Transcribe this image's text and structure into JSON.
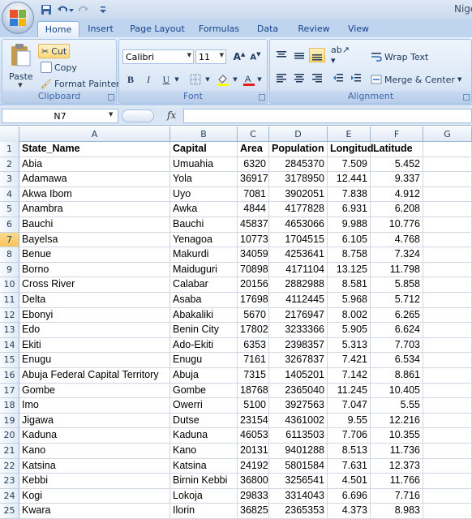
{
  "title_bar": {
    "title": "Nige"
  },
  "tabs": [
    "Home",
    "Insert",
    "Page Layout",
    "Formulas",
    "Data",
    "Review",
    "View"
  ],
  "clipboard": {
    "paste": "Paste",
    "cut": "Cut",
    "copy": "Copy",
    "format_painter": "Format Painter",
    "label": "Clipboard"
  },
  "font": {
    "name": "Calibri",
    "size": "11",
    "label": "Font",
    "bold": "B",
    "italic": "I",
    "underline": "U"
  },
  "alignment": {
    "wrap_text": "Wrap Text",
    "merge_center": "Merge & Center",
    "label": "Alignment"
  },
  "formula_bar": {
    "name_box": "N7",
    "fx": "fx",
    "formula": ""
  },
  "sheet": {
    "columns": [
      "A",
      "B",
      "C",
      "D",
      "E",
      "F",
      "G"
    ],
    "selected_row": 7,
    "rows": [
      [
        "State_Name",
        "Capital",
        "Area",
        "Population",
        "Longitud",
        "Latitude",
        ""
      ],
      [
        "Abia",
        "Umuahia",
        "6320",
        "2845370",
        "7.509",
        "5.452",
        ""
      ],
      [
        "Adamawa",
        "Yola",
        "36917",
        "3178950",
        "12.441",
        "9.337",
        ""
      ],
      [
        "Akwa Ibom",
        "Uyo",
        "7081",
        "3902051",
        "7.838",
        "4.912",
        ""
      ],
      [
        "Anambra",
        "Awka",
        "4844",
        "4177828",
        "6.931",
        "6.208",
        ""
      ],
      [
        "Bauchi",
        "Bauchi",
        "45837",
        "4653066",
        "9.988",
        "10.776",
        ""
      ],
      [
        "Bayelsa",
        "Yenagoa",
        "10773",
        "1704515",
        "6.105",
        "4.768",
        ""
      ],
      [
        "Benue",
        "Makurdi",
        "34059",
        "4253641",
        "8.758",
        "7.324",
        ""
      ],
      [
        "Borno",
        "Maiduguri",
        "70898",
        "4171104",
        "13.125",
        "11.798",
        ""
      ],
      [
        "Cross River",
        "Calabar",
        "20156",
        "2882988",
        "8.581",
        "5.858",
        ""
      ],
      [
        "Delta",
        "Asaba",
        "17698",
        "4112445",
        "5.968",
        "5.712",
        ""
      ],
      [
        "Ebonyi",
        "Abakaliki",
        "5670",
        "2176947",
        "8.002",
        "6.265",
        ""
      ],
      [
        "Edo",
        "Benin City",
        "17802",
        "3233366",
        "5.905",
        "6.624",
        ""
      ],
      [
        "Ekiti",
        "Ado-Ekiti",
        "6353",
        "2398357",
        "5.313",
        "7.703",
        ""
      ],
      [
        "Enugu",
        "Enugu",
        "7161",
        "3267837",
        "7.421",
        "6.534",
        ""
      ],
      [
        "Abuja Federal Capital Territory",
        "Abuja",
        "7315",
        "1405201",
        "7.142",
        "8.861",
        ""
      ],
      [
        "Gombe",
        "Gombe",
        "18768",
        "2365040",
        "11.245",
        "10.405",
        ""
      ],
      [
        "Imo",
        "Owerri",
        "5100",
        "3927563",
        "7.047",
        "5.55",
        ""
      ],
      [
        "Jigawa",
        "Dutse",
        "23154",
        "4361002",
        "9.55",
        "12.216",
        ""
      ],
      [
        "Kaduna",
        "Kaduna",
        "46053",
        "6113503",
        "7.706",
        "10.355",
        ""
      ],
      [
        "Kano",
        "Kano",
        "20131",
        "9401288",
        "8.513",
        "11.736",
        ""
      ],
      [
        "Katsina",
        "Katsina",
        "24192",
        "5801584",
        "7.631",
        "12.373",
        ""
      ],
      [
        "Kebbi",
        "Birnin Kebbi",
        "36800",
        "3256541",
        "4.501",
        "11.766",
        ""
      ],
      [
        "Kogi",
        "Lokoja",
        "29833",
        "3314043",
        "6.696",
        "7.716",
        ""
      ],
      [
        "Kwara",
        "Ilorin",
        "36825",
        "2365353",
        "4.373",
        "8.983",
        ""
      ]
    ]
  },
  "colors": {
    "accent": "#15428b",
    "selected_row": "#f8c45e",
    "grid_line": "#d0d7e5"
  }
}
